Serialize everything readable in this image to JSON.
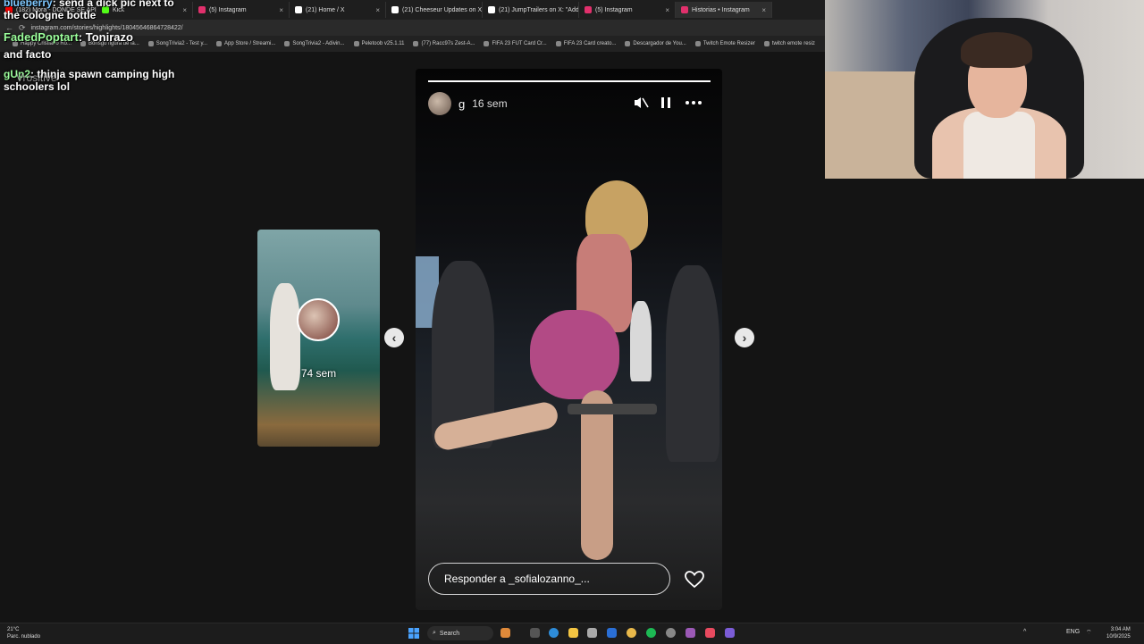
{
  "browser": {
    "tabs": [
      {
        "label": "(182) Mora - DONDE SE APRE...",
        "color": "#ff0000"
      },
      {
        "label": "Kick",
        "color": "#53fc18"
      },
      {
        "label": "(5) Instagram",
        "color": "#e1306c"
      },
      {
        "label": "(21) Home / X",
        "color": "#ffffff"
      },
      {
        "label": "(21) Cheeseur Updates on X: \"C...",
        "color": "#ffffff"
      },
      {
        "label": "(21) JumpTrailers on X: \"Addic...",
        "color": "#ffffff"
      },
      {
        "label": "(5) Instagram",
        "color": "#e1306c"
      },
      {
        "label": "Historias • Instagram",
        "color": "#e1306c"
      }
    ],
    "url": "instagram.com/stories/highlights/18045646864728422/",
    "bookmarks": [
      "Happy Cristiano Ro...",
      "Bonsgo figura de la...",
      "SongTrivia2 - Test y...",
      "App Store / Streami...",
      "SongTrivia2 - Adivin...",
      "Peletoob v25.1.11",
      "(77) Racc97s Zest-A...",
      "FIFA 23 FUT Card Cr...",
      "FIFA 23 Card creato...",
      "Descargador de You...",
      "Twitch Emote Resizer",
      "twitch emote resiz"
    ]
  },
  "chat": {
    "line1_user": "blueberry",
    "line1_text": ": send a dick pic next to the cologne bottle",
    "line2_user": "FadedPoptart",
    "line2_text": ": Tonirazo",
    "line3_text": "and facto",
    "line4_user": "gUp2",
    "line4_text": ": thinja spawn camping high schoolers lol",
    "overlap_text": "Vrositive"
  },
  "story": {
    "username": "g",
    "time": "16 sem",
    "progress": 1.0,
    "reply_placeholder": "Responder a _sofialozanno_...",
    "controls": {
      "mute": "muted-speaker-icon",
      "pause": "pause-icon",
      "more": "more-icon"
    }
  },
  "prev_story": {
    "time": "74 sem"
  },
  "nav": {
    "prev_arrow": "‹",
    "next_arrow": "›"
  },
  "taskbar": {
    "weather_temp": "21°C",
    "weather_desc": "Parc. nublado",
    "search_label": "Search",
    "lang": "ENG",
    "time": "3:04 AM",
    "date": "10/9/2025"
  }
}
